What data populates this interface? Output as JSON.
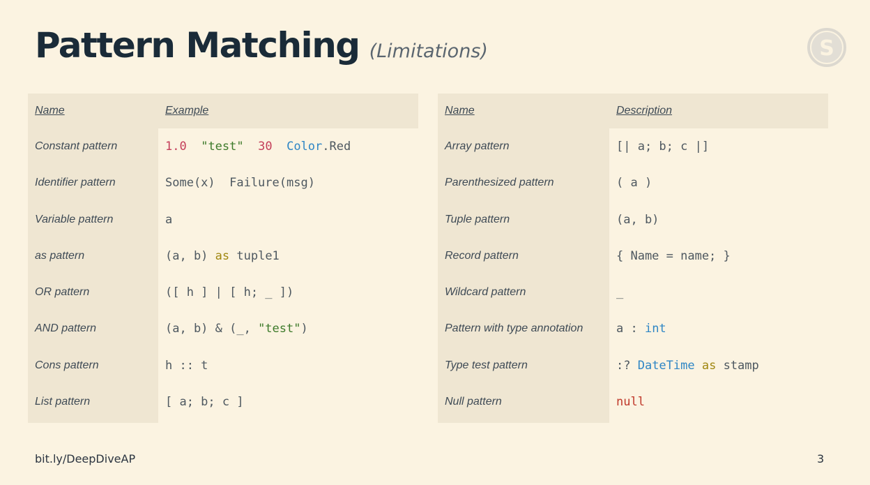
{
  "title": {
    "main": "Pattern Matching",
    "sub": "(Limitations)"
  },
  "logo": {
    "icon": "skype-icon",
    "letter": "S"
  },
  "left_table": {
    "headers": {
      "name": "Name",
      "example": "Example"
    },
    "rows": [
      {
        "name": "Constant pattern",
        "tokens": [
          {
            "t": "1.0",
            "c": "num"
          },
          {
            "t": "  "
          },
          {
            "t": "\"test\"",
            "c": "str"
          },
          {
            "t": "  "
          },
          {
            "t": "30",
            "c": "num"
          },
          {
            "t": "  "
          },
          {
            "t": "Color",
            "c": "type"
          },
          {
            "t": ".Red"
          }
        ]
      },
      {
        "name": "Identifier pattern",
        "tokens": [
          {
            "t": "Some(x)  Failure(msg)"
          }
        ]
      },
      {
        "name": "Variable pattern",
        "tokens": [
          {
            "t": "a"
          }
        ]
      },
      {
        "name": "as pattern",
        "tokens": [
          {
            "t": "(a, b) "
          },
          {
            "t": "as",
            "c": "kw"
          },
          {
            "t": " tuple1"
          }
        ]
      },
      {
        "name": "OR pattern",
        "tokens": [
          {
            "t": "([ h ] | [ h; _ ])"
          }
        ]
      },
      {
        "name": "AND pattern",
        "tokens": [
          {
            "t": "(a, b) & (_, "
          },
          {
            "t": "\"test\"",
            "c": "str"
          },
          {
            "t": ")"
          }
        ]
      },
      {
        "name": "Cons pattern",
        "tokens": [
          {
            "t": "h :: t"
          }
        ]
      },
      {
        "name": "List pattern",
        "tokens": [
          {
            "t": "[ a; b; c ]"
          }
        ]
      }
    ]
  },
  "right_table": {
    "headers": {
      "name": "Name",
      "description": "Description"
    },
    "rows": [
      {
        "name": "Array pattern",
        "tokens": [
          {
            "t": "[| a; b; c |]"
          }
        ]
      },
      {
        "name": "Parenthesized pattern",
        "tokens": [
          {
            "t": "( a )"
          }
        ]
      },
      {
        "name": "Tuple pattern",
        "tokens": [
          {
            "t": "(a, b)"
          }
        ]
      },
      {
        "name": "Record pattern",
        "tokens": [
          {
            "t": "{ Name = name; }"
          }
        ]
      },
      {
        "name": "Wildcard pattern",
        "tokens": [
          {
            "t": "_"
          }
        ]
      },
      {
        "name": "Pattern with type annotation",
        "tokens": [
          {
            "t": "a : "
          },
          {
            "t": "int",
            "c": "type"
          }
        ]
      },
      {
        "name": "Type test pattern",
        "tokens": [
          {
            "t": ":? "
          },
          {
            "t": "DateTime",
            "c": "type"
          },
          {
            "t": " "
          },
          {
            "t": "as",
            "c": "kw"
          },
          {
            "t": " stamp"
          }
        ]
      },
      {
        "name": "Null pattern",
        "tokens": [
          {
            "t": "null",
            "c": "null"
          }
        ]
      }
    ]
  },
  "footer": {
    "link": "bit.ly/DeepDiveAP",
    "page_number": "3"
  }
}
